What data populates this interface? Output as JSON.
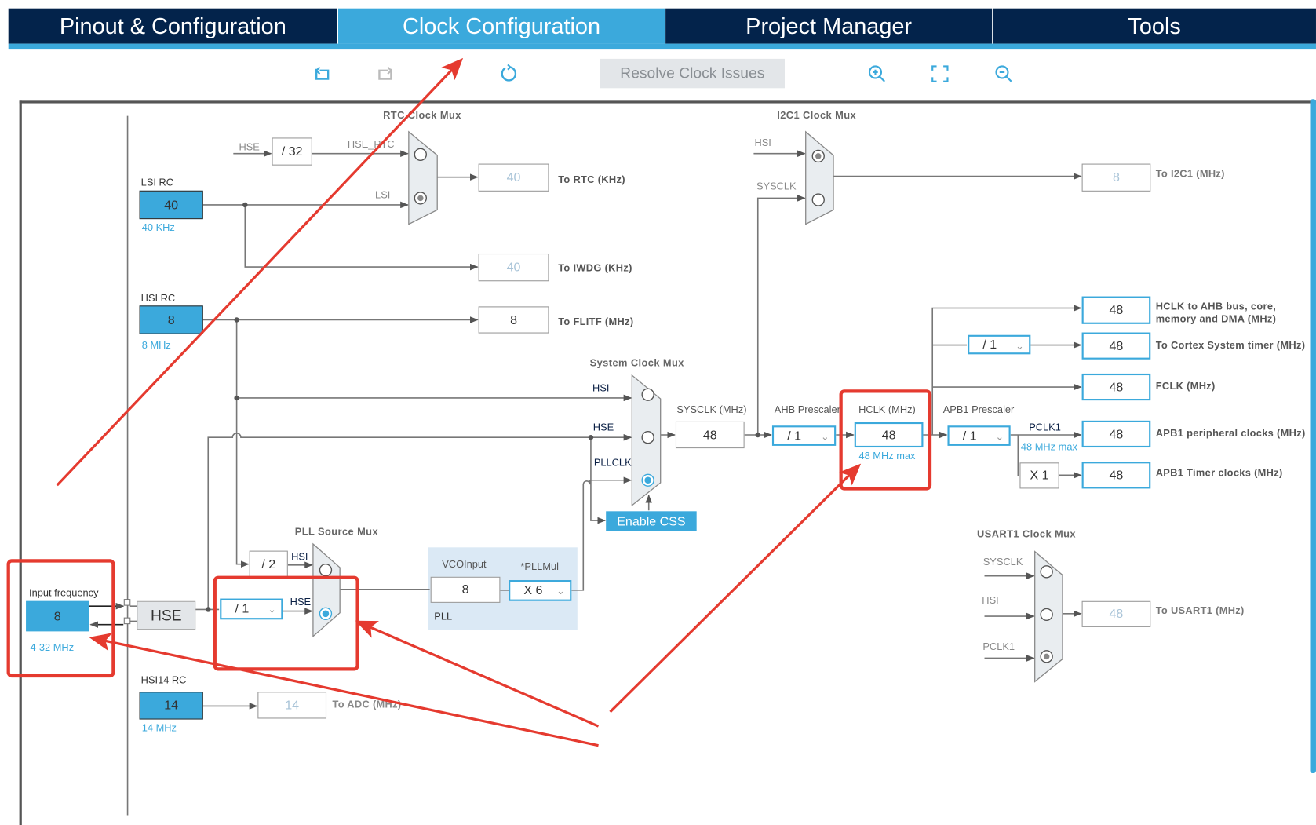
{
  "tabs": [
    {
      "label": "Pinout & Configuration",
      "active": false
    },
    {
      "label": "Clock Configuration",
      "active": true
    },
    {
      "label": "Project Manager",
      "active": false
    },
    {
      "label": "Tools",
      "active": false
    }
  ],
  "toolbar": {
    "undo_icon": "undo-icon",
    "redo_icon": "redo-icon",
    "refresh_icon": "refresh-icon",
    "resolve_label": "Resolve Clock Issues",
    "zoom_in_icon": "zoom-in-icon",
    "fit_icon": "fit-screen-icon",
    "zoom_out_icon": "zoom-out-icon"
  },
  "colors": {
    "brand_dark": "#03234b",
    "accent": "#3ba9dc",
    "annotation": "#e53a2f",
    "pll_bg": "#dbe9f5"
  },
  "sources": {
    "lsi": {
      "label": "LSI RC",
      "value": "40",
      "unit": "40 KHz"
    },
    "hsi": {
      "label": "HSI RC",
      "value": "8",
      "unit": "8 MHz"
    },
    "hsi14": {
      "label": "HSI14 RC",
      "value": "14",
      "unit": "14 MHz"
    },
    "input": {
      "label": "Input frequency",
      "value": "8",
      "range": "4-32 MHz"
    },
    "hse": {
      "label": "HSE"
    }
  },
  "rtc": {
    "title": "RTC Clock Mux",
    "hse_label": "HSE",
    "div": "/ 32",
    "hse_rtc_label": "HSE_RTC",
    "lsi_label": "LSI",
    "out_value": "40",
    "out_label": "To RTC (KHz)"
  },
  "iwdg": {
    "value": "40",
    "label": "To IWDG (KHz)"
  },
  "flitf": {
    "value": "8",
    "label": "To FLITF (MHz)"
  },
  "sysmux": {
    "title": "System Clock Mux",
    "hsi": "HSI",
    "hse": "HSE",
    "pllclk": "PLLCLK",
    "enable_css": "Enable CSS"
  },
  "sysclk": {
    "label": "SYSCLK (MHz)",
    "value": "48"
  },
  "ahb": {
    "label": "AHB Prescaler",
    "value": "/ 1"
  },
  "hclk": {
    "label": "HCLK (MHz)",
    "value": "48",
    "max": "48 MHz max"
  },
  "apb1": {
    "label": "APB1 Prescaler",
    "value": "/ 1",
    "pclk1": "PCLK1",
    "max": "48 MHz max",
    "timer_mul": "X 1"
  },
  "cortex_div": "/ 1",
  "outputs": [
    {
      "value": "48",
      "label": "HCLK to AHB bus, core, memory and DMA (MHz)"
    },
    {
      "value": "48",
      "label": "To Cortex System timer (MHz)"
    },
    {
      "value": "48",
      "label": "FCLK (MHz)"
    },
    {
      "value": "48",
      "label": "APB1 peripheral clocks (MHz)"
    },
    {
      "value": "48",
      "label": "APB1 Timer clocks (MHz)"
    }
  ],
  "i2c": {
    "title": "I2C1 Clock Mux",
    "hsi": "HSI",
    "sysclk": "SYSCLK",
    "value": "8",
    "label": "To I2C1 (MHz)"
  },
  "usart": {
    "title": "USART1 Clock Mux",
    "sysclk": "SYSCLK",
    "hsi": "HSI",
    "pclk1": "PCLK1",
    "value": "48",
    "label": "To USART1 (MHz)"
  },
  "pllsrc": {
    "title": "PLL Source Mux",
    "div2": "/ 2",
    "hsi": "HSI",
    "hse_div": "/ 1",
    "hse": "HSE"
  },
  "pll": {
    "vco_label": "VCOInput",
    "vco_value": "8",
    "mul_label": "*PLLMul",
    "mul_value": "X 6",
    "name": "PLL"
  },
  "adc": {
    "value": "14",
    "label": "To ADC (MHz)"
  }
}
